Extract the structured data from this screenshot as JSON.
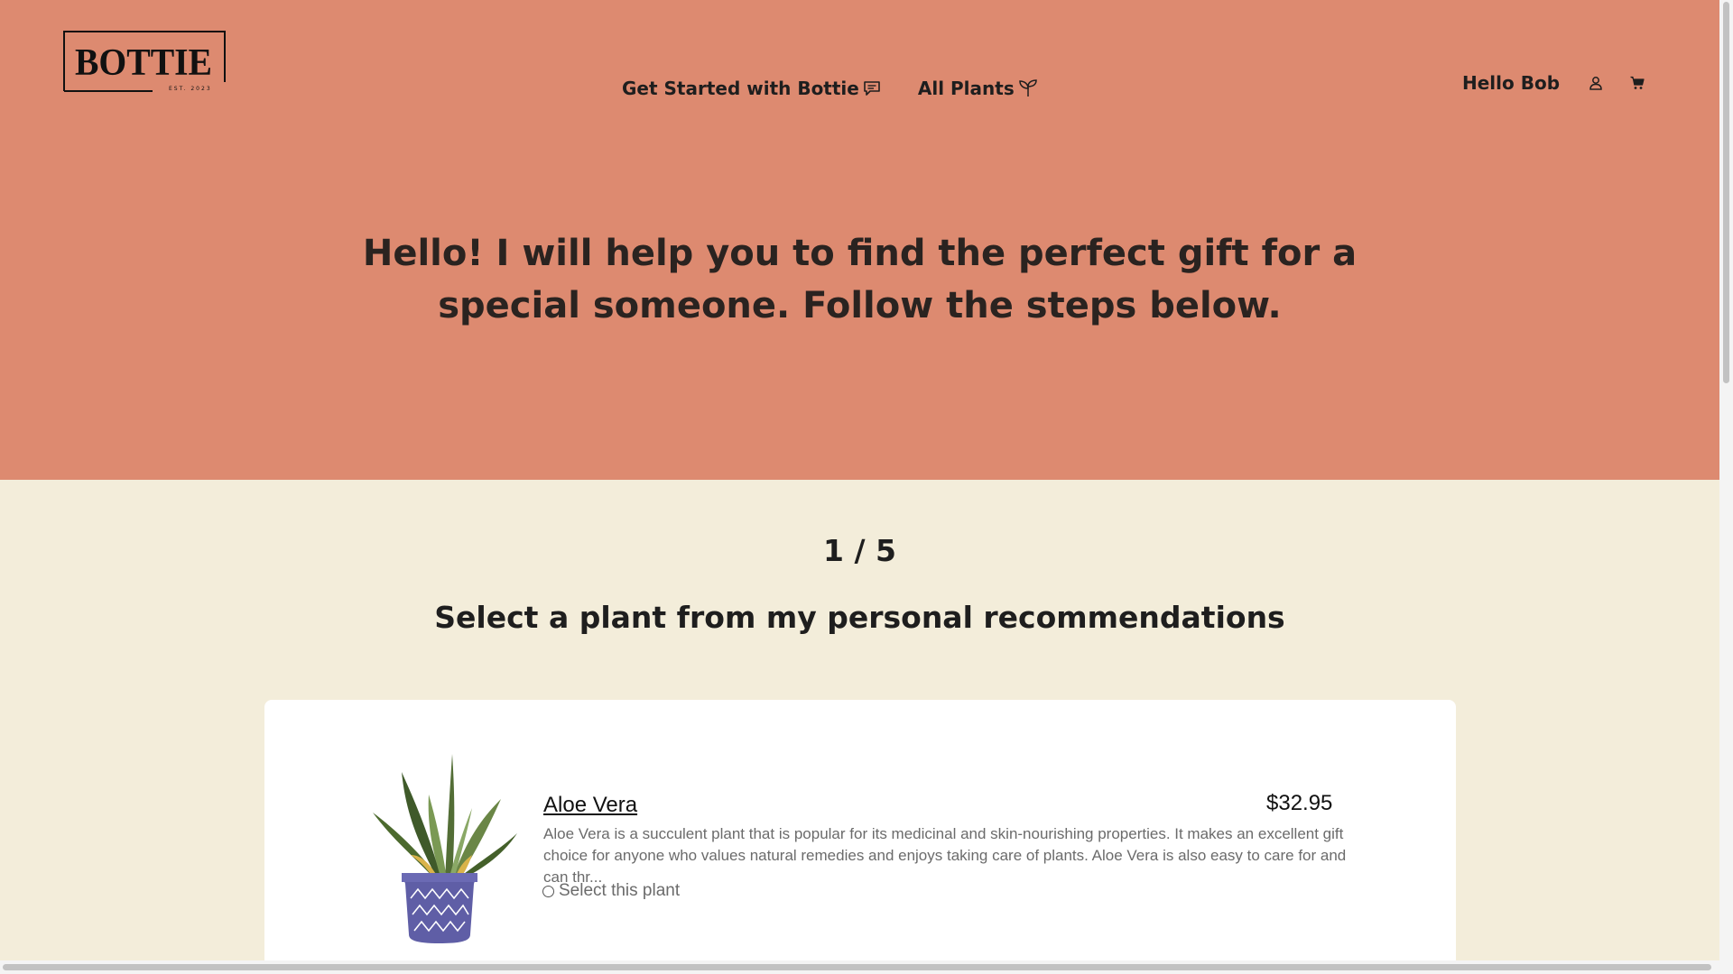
{
  "header": {
    "logo_text": "BOTTIE",
    "logo_subtext": "EST. 2023",
    "nav": [
      {
        "label": "Get Started with Bottie",
        "icon": "chat-icon"
      },
      {
        "label": "All Plants",
        "icon": "sprout-icon"
      }
    ],
    "greeting": "Hello Bob",
    "user_icon": "user-icon",
    "cart_icon": "cart-icon"
  },
  "hero": {
    "title": "Hello! I will help you to find the perfect gift for a special someone. Follow the steps below."
  },
  "steps": {
    "counter": "1 / 5",
    "title": "Select a plant from my personal recommendations"
  },
  "plants": [
    {
      "name": "Aloe Vera",
      "price": "$32.95",
      "description": "Aloe Vera is a succulent plant that is popular for its medicinal and skin-nourishing properties. It makes an excellent gift choice for anyone who values natural remedies and enjoys taking care of plants. Aloe Vera is also easy to care for and can thr...",
      "select_label": "Select this plant",
      "selected": false
    }
  ],
  "colors": {
    "hero_bg": "#dd8a70",
    "page_bg": "#f3edda",
    "card_bg": "#ffffff",
    "pot": "#5f5ea6"
  }
}
